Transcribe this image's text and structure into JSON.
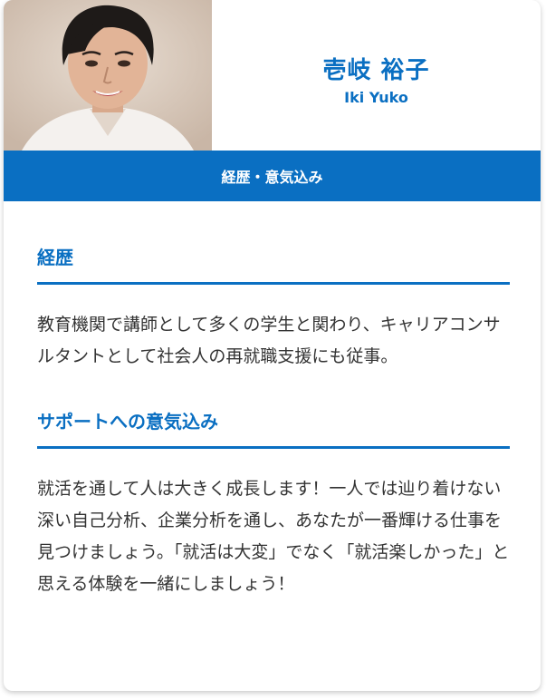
{
  "profile": {
    "name_jp": "壱岐 裕子",
    "name_en": "Iki Yuko"
  },
  "banner": {
    "label": "経歴・意気込み"
  },
  "sections": [
    {
      "title": "経歴",
      "body": "教育機関で講師として多くの学生と関わり、キャリアコンサルタントとして社会人の再就職支援にも従事。"
    },
    {
      "title": "サポートへの意気込み",
      "body": "就活を通して人は大きく成長します！一人では辿り着けない深い自己分析、企業分析を通し、あなたが一番輝ける仕事を見つけましょう。「就活は大変」でなく「就活楽しかった」と思える体験を一緒にしましょう！"
    }
  ],
  "colors": {
    "accent": "#0a6fc2",
    "text": "#333333",
    "banner_text": "#ffffff"
  }
}
